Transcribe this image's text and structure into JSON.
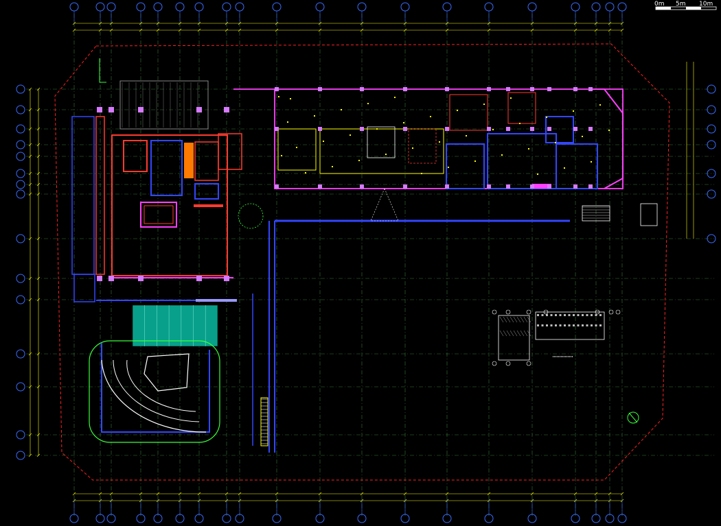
{
  "drawing": {
    "background": "#000000",
    "colors": {
      "grid": "#00c8ff",
      "grid_dash": "#3a7a3a",
      "dim": "#ffff00",
      "bubble": "#3a6cff",
      "boundary": "#ff2020",
      "wall_red": "#ff3b2f",
      "wall_blue": "#3346ff",
      "wall_magenta": "#ff40ff",
      "column_pink": "#d67aff",
      "teal": "#08a08a",
      "green": "#39ff39",
      "white": "#ffffff",
      "orange": "#ff7a00"
    },
    "scale_bar": {
      "labels": [
        "0m",
        "5m",
        "10m"
      ]
    }
  }
}
